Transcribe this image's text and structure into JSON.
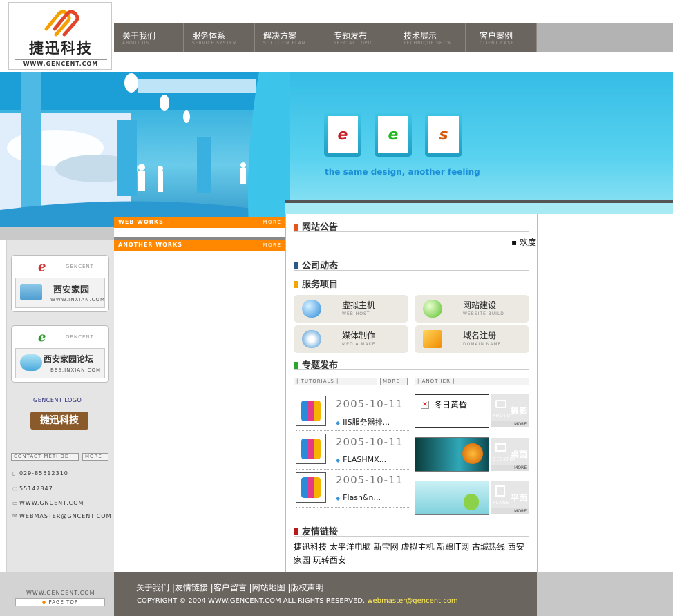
{
  "header": {
    "logo_title": "捷迅科技",
    "logo_url": "WWW.GENCENT.COM",
    "nav": [
      {
        "cn": "关于我们",
        "en": "ABOUT US"
      },
      {
        "cn": "服务体系",
        "en": "SERVICE SYSTEM"
      },
      {
        "cn": "解决方案",
        "en": "SOLUTION PLAN"
      },
      {
        "cn": "专题发布",
        "en": "SPECIAL TOPIC"
      },
      {
        "cn": "技术展示",
        "en": "TECHNIQUE SHOW"
      },
      {
        "cn": "客户案例",
        "en": "CLIENT CASE"
      }
    ]
  },
  "banner": {
    "tagline": "the same design, another feeling",
    "logos": [
      "e",
      "e",
      "s"
    ]
  },
  "left": {
    "partners": [
      {
        "brand": "GENCENT",
        "name": "西安家园",
        "url": "WWW.INXIAN.COM"
      },
      {
        "brand": "GENCENT",
        "name": "西安家园论坛",
        "url": "BBS.INXIAN.COM"
      }
    ],
    "logo_label": "GENCENT LOGO",
    "logo_badge": "捷迅科技",
    "contact_label": "CONTACT METHOD",
    "more_label": "MORE",
    "contacts": [
      {
        "icon": "phone-icon",
        "text": "029-85512310"
      },
      {
        "icon": "qq-icon",
        "text": "55147847"
      },
      {
        "icon": "web-icon",
        "text": "WWW.GNCENT.COM"
      },
      {
        "icon": "mail-icon",
        "text": "WEBMASTER@GNCENT.COM"
      }
    ],
    "bottom_url": "WWW.GENCENT.COM",
    "page_top": "PAGE TOP"
  },
  "works": {
    "web_works": "WEB WORKS",
    "another_works": "ANOTHER WORKS",
    "more": "MORE"
  },
  "main": {
    "notice_title": "网站公告",
    "notice_text": "▪ 欢度",
    "news_title": "公司动态",
    "service_title": "服务项目",
    "services": [
      {
        "cn": "虚拟主机",
        "en": "WEB HOST"
      },
      {
        "cn": "网站建设",
        "en": "WEBSITE BUILD"
      },
      {
        "cn": "媒体制作",
        "en": "MEDIA MAKE"
      },
      {
        "cn": "域名注册",
        "en": "DOMAIN NAME"
      }
    ],
    "topic_title": "专题发布",
    "tutorials_label": "| TUTORIALS |",
    "another_label": "| ANOTHER |",
    "more": "MORE",
    "topics": [
      {
        "date": "2005-10-11",
        "title": "IIS服务器排..."
      },
      {
        "date": "2005-10-11",
        "title": "FLASHMX..."
      },
      {
        "date": "2005-10-11",
        "title": "Flash&n..."
      }
    ],
    "another_first_title": "冬日黄昏",
    "categories": [
      {
        "cn": "摄影",
        "en": "PHOTO"
      },
      {
        "cn": "桌面",
        "en": "DESKTOP"
      },
      {
        "cn": "平面",
        "en": "PLANE"
      }
    ],
    "links_title": "友情链接",
    "links": "捷迅科技 太平洋电脑 新宝网 虚拟主机 新疆IT网 古城热线 西安家园 玩转西安"
  },
  "footer": {
    "links": "关于我们 |友情链接 |客户留言 |网站地图 |版权声明",
    "copyright": "COPYRIGHT © 2004 WWW.GENCENT.COM ALL RIGHTS RESERVED.",
    "email": "webmaster@gencent.com"
  },
  "colors": {
    "nav_bg": "#6b6560",
    "orange": "#ff8800",
    "banner_blue": "#35bde6"
  }
}
